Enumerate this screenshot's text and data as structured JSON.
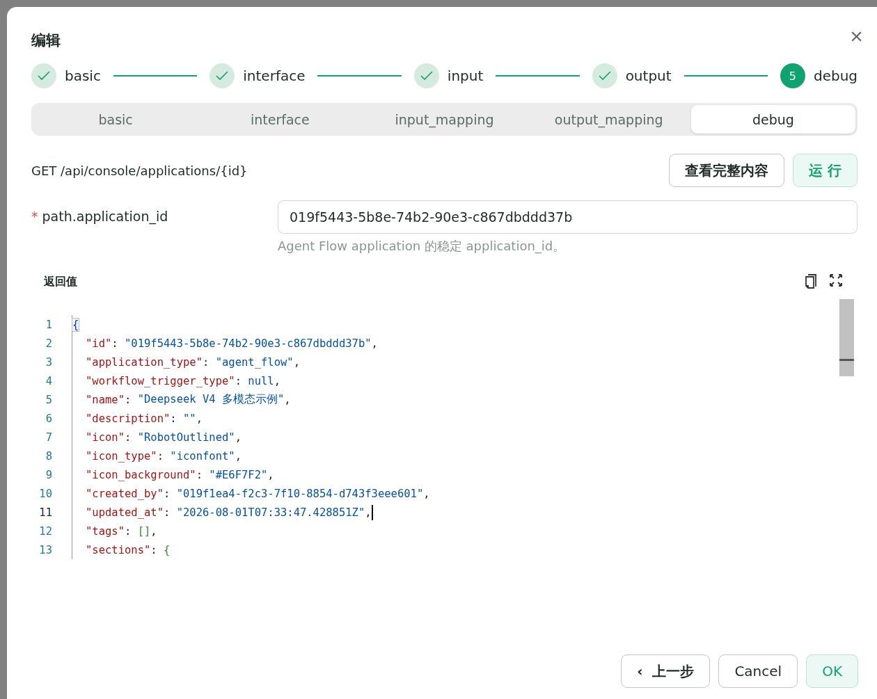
{
  "dialog": {
    "title": "编辑",
    "close_icon": "×"
  },
  "steps": [
    {
      "label": "basic",
      "done": true
    },
    {
      "label": "interface",
      "done": true
    },
    {
      "label": "input",
      "done": true
    },
    {
      "label": "output",
      "done": true
    },
    {
      "label": "debug",
      "done": false,
      "number": "5"
    }
  ],
  "tabs": [
    {
      "label": "basic",
      "selected": false
    },
    {
      "label": "interface",
      "selected": false
    },
    {
      "label": "input_mapping",
      "selected": false
    },
    {
      "label": "output_mapping",
      "selected": false
    },
    {
      "label": "debug",
      "selected": true
    }
  ],
  "endpoint": "GET /api/console/applications/{id}",
  "actions": [
    {
      "label": "查看完整内容",
      "kind": "default"
    },
    {
      "label": "运 行",
      "kind": "primary"
    }
  ],
  "field": {
    "required_mark": "*",
    "label": "path.application_id",
    "value": "019f5443-5b8e-74b2-90e3-c867dbddd37b",
    "help": "Agent Flow application 的稳定 application_id。"
  },
  "result": {
    "title": "返回值",
    "lines": [
      {
        "number": "1",
        "cursor": false,
        "tokens": [
          {
            "kind": "brace",
            "text": "{",
            "matched": true
          }
        ]
      },
      {
        "number": "2",
        "cursor": false,
        "tokens": [
          {
            "kind": "key",
            "text": "\"id\""
          },
          {
            "kind": "punct",
            "text": ": "
          },
          {
            "kind": "string",
            "text": "\"019f5443-5b8e-74b2-90e3-c867dbddd37b\""
          },
          {
            "kind": "punct",
            "text": ","
          }
        ]
      },
      {
        "number": "3",
        "cursor": false,
        "tokens": [
          {
            "kind": "key",
            "text": "\"application_type\""
          },
          {
            "kind": "punct",
            "text": ": "
          },
          {
            "kind": "string",
            "text": "\"agent_flow\""
          },
          {
            "kind": "punct",
            "text": ","
          }
        ]
      },
      {
        "number": "4",
        "cursor": false,
        "tokens": [
          {
            "kind": "key",
            "text": "\"workflow_trigger_type\""
          },
          {
            "kind": "punct",
            "text": ": "
          },
          {
            "kind": "keyword",
            "text": "null"
          },
          {
            "kind": "punct",
            "text": ","
          }
        ]
      },
      {
        "number": "5",
        "cursor": false,
        "tokens": [
          {
            "kind": "key",
            "text": "\"name\""
          },
          {
            "kind": "punct",
            "text": ": "
          },
          {
            "kind": "string",
            "text": "\"Deepseek V4 多模态示例\""
          },
          {
            "kind": "punct",
            "text": ","
          }
        ]
      },
      {
        "number": "6",
        "cursor": false,
        "tokens": [
          {
            "kind": "key",
            "text": "\"description\""
          },
          {
            "kind": "punct",
            "text": ": "
          },
          {
            "kind": "string",
            "text": "\"\""
          },
          {
            "kind": "punct",
            "text": ","
          }
        ]
      },
      {
        "number": "7",
        "cursor": false,
        "tokens": [
          {
            "kind": "key",
            "text": "\"icon\""
          },
          {
            "kind": "punct",
            "text": ": "
          },
          {
            "kind": "string",
            "text": "\"RobotOutlined\""
          },
          {
            "kind": "punct",
            "text": ","
          }
        ]
      },
      {
        "number": "8",
        "cursor": false,
        "tokens": [
          {
            "kind": "key",
            "text": "\"icon_type\""
          },
          {
            "kind": "punct",
            "text": ": "
          },
          {
            "kind": "string",
            "text": "\"iconfont\""
          },
          {
            "kind": "punct",
            "text": ","
          }
        ]
      },
      {
        "number": "9",
        "cursor": false,
        "tokens": [
          {
            "kind": "key",
            "text": "\"icon_background\""
          },
          {
            "kind": "punct",
            "text": ": "
          },
          {
            "kind": "string",
            "text": "\"#E6F7F2\""
          },
          {
            "kind": "punct",
            "text": ","
          }
        ]
      },
      {
        "number": "10",
        "cursor": false,
        "tokens": [
          {
            "kind": "key",
            "text": "\"created_by\""
          },
          {
            "kind": "punct",
            "text": ": "
          },
          {
            "kind": "string",
            "text": "\"019f1ea4-f2c3-7f10-8854-d743f3eee601\""
          },
          {
            "kind": "punct",
            "text": ","
          }
        ]
      },
      {
        "number": "11",
        "cursor": true,
        "tokens": [
          {
            "kind": "key",
            "text": "\"updated_at\""
          },
          {
            "kind": "punct",
            "text": ": "
          },
          {
            "kind": "string",
            "text": "\"2026-08-01T07:33:47.428851Z\""
          },
          {
            "kind": "punct",
            "text": ","
          }
        ]
      },
      {
        "number": "12",
        "cursor": false,
        "tokens": [
          {
            "kind": "key",
            "text": "\"tags\""
          },
          {
            "kind": "punct",
            "text": ": "
          },
          {
            "kind": "bracket",
            "text": "[]"
          },
          {
            "kind": "punct",
            "text": ","
          }
        ]
      },
      {
        "number": "13",
        "cursor": false,
        "tokens": [
          {
            "kind": "key",
            "text": "\"sections\""
          },
          {
            "kind": "punct",
            "text": ": "
          },
          {
            "kind": "bracket",
            "text": "{"
          }
        ]
      }
    ]
  },
  "footer": [
    {
      "label": "上一步",
      "kind": "back",
      "icon": "‹"
    },
    {
      "label": "Cancel",
      "kind": "default"
    },
    {
      "label": "OK",
      "kind": "primary"
    }
  ]
}
